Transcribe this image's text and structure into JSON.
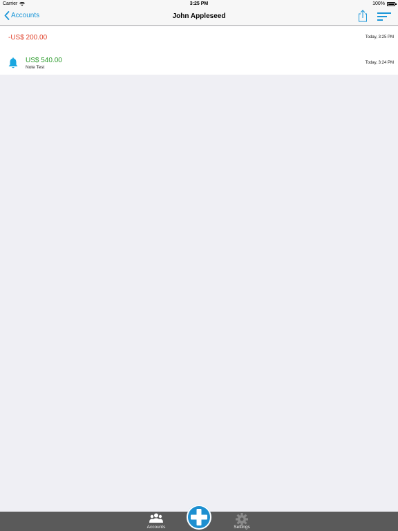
{
  "status_bar": {
    "carrier": "Carrier",
    "time": "3:25 PM",
    "battery": "100%"
  },
  "nav": {
    "back_label": "Accounts",
    "title": "John Appleseed"
  },
  "transactions": [
    {
      "amount": "-US$ 200.00",
      "date": "Today, 3:25 PM",
      "note": "",
      "has_reminder": false
    },
    {
      "amount": "US$ 540.00",
      "date": "Today, 3:24 PM",
      "note": "Note Test",
      "has_reminder": true
    }
  ],
  "tab_bar": {
    "accounts_label": "Accounts",
    "settings_label": "Settings"
  },
  "colors": {
    "accent": "#1a96d8",
    "negative": "#e0412a",
    "positive": "#2a9a2a",
    "tab_bar": "#5a5a5a"
  },
  "icons": [
    "wifi-icon",
    "back-chevron-icon",
    "share-icon",
    "sort-icon",
    "bell-icon",
    "accounts-icon",
    "add-icon",
    "gear-icon"
  ]
}
